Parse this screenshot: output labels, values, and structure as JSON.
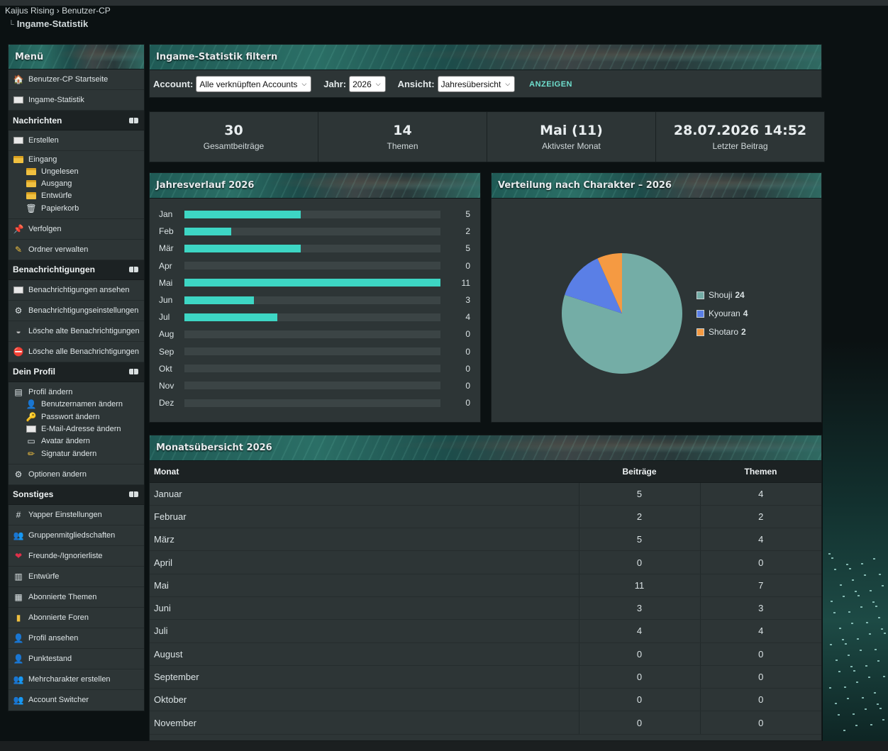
{
  "breadcrumb": {
    "forum": "Kaijus Rising",
    "sep": "›",
    "section": "Benutzer-CP",
    "page": "Ingame-Statistik"
  },
  "sidebar": {
    "title": "Menü",
    "top": [
      {
        "label": "Benutzer-CP Startseite",
        "icon": "house-icon"
      },
      {
        "label": "Ingame-Statistik",
        "icon": "mail-icon"
      }
    ],
    "nachrichten": {
      "title": "Nachrichten",
      "items": [
        {
          "label": "Erstellen"
        },
        {
          "label": "Eingang"
        },
        {
          "label": "Ungelesen"
        },
        {
          "label": "Ausgang"
        },
        {
          "label": "Entwürfe"
        },
        {
          "label": "Papierkorb"
        },
        {
          "label": "Verfolgen"
        },
        {
          "label": "Ordner verwalten"
        }
      ]
    },
    "benachrichtigungen": {
      "title": "Benachrichtigungen",
      "items": [
        {
          "label": "Benachrichtigungen ansehen"
        },
        {
          "label": "Benachrichtigungseinstellungen"
        },
        {
          "label": "Lösche alte Benachrichtigungen"
        },
        {
          "label": "Lösche alle Benachrichtigungen"
        }
      ]
    },
    "profil": {
      "title": "Dein Profil",
      "items": [
        {
          "label": "Profil ändern"
        },
        {
          "label": "Benutzernamen ändern"
        },
        {
          "label": "Passwort ändern"
        },
        {
          "label": "E-Mail-Adresse ändern"
        },
        {
          "label": "Avatar ändern"
        },
        {
          "label": "Signatur ändern"
        },
        {
          "label": "Optionen ändern"
        }
      ]
    },
    "sonstiges": {
      "title": "Sonstiges",
      "items": [
        {
          "label": "Yapper Einstellungen"
        },
        {
          "label": "Gruppenmitgliedschaften"
        },
        {
          "label": "Freunde-/Ignorierliste"
        },
        {
          "label": "Entwürfe"
        },
        {
          "label": "Abonnierte Themen"
        },
        {
          "label": "Abonnierte Foren"
        },
        {
          "label": "Profil ansehen"
        },
        {
          "label": "Punktestand"
        },
        {
          "label": "Mehrcharakter erstellen"
        },
        {
          "label": "Account Switcher"
        }
      ]
    }
  },
  "filter": {
    "title": "Ingame-Statistik filtern",
    "account_label": "Account:",
    "account_value": "Alle verknüpften Accounts",
    "year_label": "Jahr:",
    "year_value": "2026",
    "view_label": "Ansicht:",
    "view_value": "Jahresübersicht",
    "show_button": "ANZEIGEN"
  },
  "stats": [
    {
      "value": "30",
      "label": "Gesamtbeiträge"
    },
    {
      "value": "14",
      "label": "Themen"
    },
    {
      "value": "Mai (11)",
      "label": "Aktivster Monat"
    },
    {
      "value": "28.07.2026 14:52",
      "label": "Letzter Beitrag"
    }
  ],
  "colors": {
    "accent": "#3dd6c4",
    "pie_shouji": "#74ada6",
    "pie_kyouran": "#5a7fe6",
    "pie_shotaro": "#f59a42"
  },
  "yearly": {
    "title": "Jahresverlauf 2026",
    "chart_data": {
      "type": "bar",
      "categories": [
        "Jan",
        "Feb",
        "Mär",
        "Apr",
        "Mai",
        "Jun",
        "Jul",
        "Aug",
        "Sep",
        "Okt",
        "Nov",
        "Dez"
      ],
      "values": [
        5,
        2,
        5,
        0,
        11,
        3,
        4,
        0,
        0,
        0,
        0,
        0
      ],
      "ylim": [
        0,
        11
      ]
    }
  },
  "distribution": {
    "title": "Verteilung nach Charakter – 2026",
    "chart_data": {
      "type": "pie",
      "categories": [
        "Shouji",
        "Kyouran",
        "Shotaro"
      ],
      "values": [
        24,
        4,
        2
      ],
      "legend": "right"
    }
  },
  "monthly": {
    "title": "Monatsübersicht 2026",
    "headers": [
      "Monat",
      "Beiträge",
      "Themen"
    ],
    "rows": [
      [
        "Januar",
        "5",
        "4"
      ],
      [
        "Februar",
        "2",
        "2"
      ],
      [
        "März",
        "5",
        "4"
      ],
      [
        "April",
        "0",
        "0"
      ],
      [
        "Mai",
        "11",
        "7"
      ],
      [
        "Juni",
        "3",
        "3"
      ],
      [
        "Juli",
        "4",
        "4"
      ],
      [
        "August",
        "0",
        "0"
      ],
      [
        "September",
        "0",
        "0"
      ],
      [
        "Oktober",
        "0",
        "0"
      ],
      [
        "November",
        "0",
        "0"
      ]
    ]
  }
}
